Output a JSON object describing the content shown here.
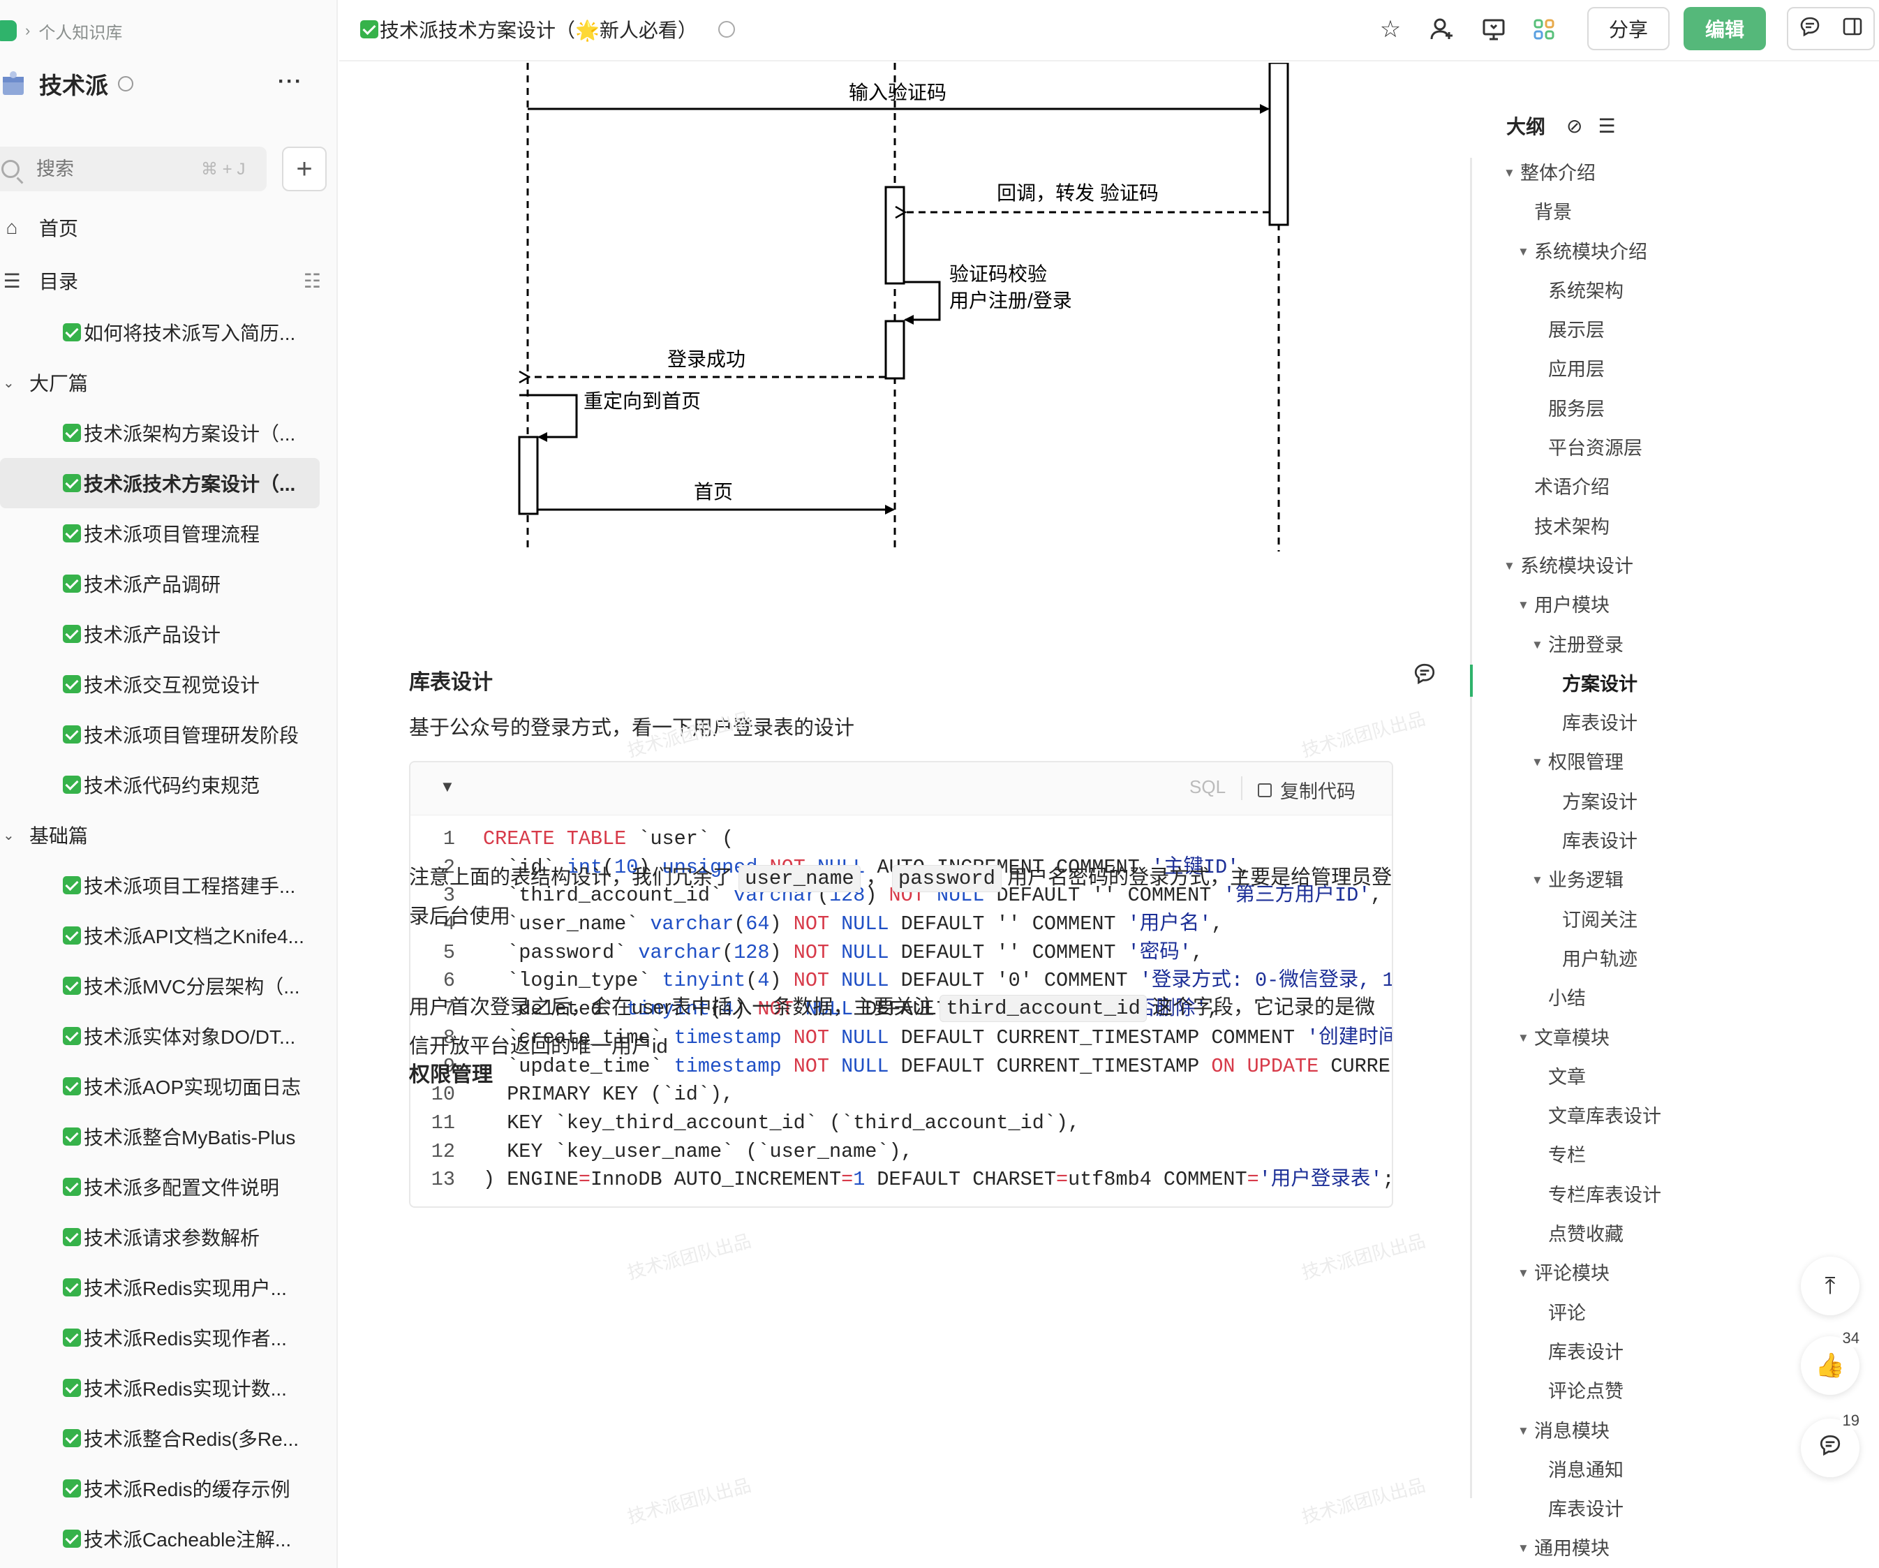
{
  "breadcrumb": {
    "label": "个人知识库"
  },
  "book": {
    "title": "技术派",
    "more": "···"
  },
  "search": {
    "placeholder": "搜索",
    "shortcut": "⌘ + J",
    "add": "+"
  },
  "nav": {
    "home": "首页",
    "toc": "目录"
  },
  "tree": [
    {
      "type": "doc",
      "label": "如何将技术派写入简历..."
    },
    {
      "type": "group",
      "label": "大厂篇"
    },
    {
      "type": "doc",
      "label": "技术派架构方案设计（..."
    },
    {
      "type": "doc",
      "label": "技术派技术方案设计（...",
      "active": true
    },
    {
      "type": "doc",
      "label": "技术派项目管理流程"
    },
    {
      "type": "doc",
      "label": "技术派产品调研"
    },
    {
      "type": "doc",
      "label": "技术派产品设计"
    },
    {
      "type": "doc",
      "label": "技术派交互视觉设计"
    },
    {
      "type": "doc",
      "label": "技术派项目管理研发阶段"
    },
    {
      "type": "doc",
      "label": "技术派代码约束规范"
    },
    {
      "type": "group",
      "label": "基础篇"
    },
    {
      "type": "doc",
      "label": "技术派项目工程搭建手..."
    },
    {
      "type": "doc",
      "label": "技术派API文档之Knife4..."
    },
    {
      "type": "doc",
      "label": "技术派MVC分层架构（..."
    },
    {
      "type": "doc",
      "label": "技术派实体对象DO/DT..."
    },
    {
      "type": "doc",
      "label": "技术派AOP实现切面日志"
    },
    {
      "type": "doc",
      "label": "技术派整合MyBatis-Plus"
    },
    {
      "type": "doc",
      "label": "技术派多配置文件说明"
    },
    {
      "type": "doc",
      "label": "技术派请求参数解析"
    },
    {
      "type": "doc",
      "label": "技术派Redis实现用户..."
    },
    {
      "type": "doc",
      "label": "技术派Redis实现作者..."
    },
    {
      "type": "doc",
      "label": "技术派Redis实现计数..."
    },
    {
      "type": "doc",
      "label": "技术派整合Redis(多Re..."
    },
    {
      "type": "doc",
      "label": "技术派Redis的缓存示例"
    },
    {
      "type": "doc",
      "label": "技术派Cacheable注解..."
    }
  ],
  "topbar": {
    "doc_title": "技术派技术方案设计（🌟新人必看）",
    "share": "分享",
    "edit": "编辑"
  },
  "diagram": {
    "msg1": "输入验证码",
    "msg2": "回调，转发 验证码",
    "self1_line1": "验证码校验",
    "self1_line2": "用户注册/登录",
    "msg3": "登录成功",
    "self2": "重定向到首页",
    "msg4": "首页"
  },
  "section1": {
    "title": "库表设计",
    "intro": "基于公众号的登录方式，看一下用户登录表的设计"
  },
  "code": {
    "lang": "SQL",
    "copy": "复制代码",
    "lines": [
      [
        [
          "kw",
          "CREATE TABLE"
        ],
        [
          "p",
          " `user` ("
        ]
      ],
      [
        [
          "p",
          "  `id` "
        ],
        [
          "ty",
          "int"
        ],
        [
          "p",
          "("
        ],
        [
          "num",
          "10"
        ],
        [
          "p",
          ") "
        ],
        [
          "ty",
          "unsigned"
        ],
        [
          "p",
          " "
        ],
        [
          "kw",
          "NOT"
        ],
        [
          "p",
          " "
        ],
        [
          "ty",
          "NULL"
        ],
        [
          "p",
          " AUTO_INCREMENT COMMENT "
        ],
        [
          "st",
          "'主键ID'"
        ],
        [
          "p",
          ","
        ]
      ],
      [
        [
          "p",
          "  `third_account_id` "
        ],
        [
          "ty",
          "varchar"
        ],
        [
          "p",
          "("
        ],
        [
          "num",
          "128"
        ],
        [
          "p",
          ") "
        ],
        [
          "kw",
          "NOT"
        ],
        [
          "p",
          " "
        ],
        [
          "ty",
          "NULL"
        ],
        [
          "p",
          " DEFAULT '' COMMENT "
        ],
        [
          "st",
          "'第三方用户ID'"
        ],
        [
          "p",
          ","
        ]
      ],
      [
        [
          "p",
          "  `user_name` "
        ],
        [
          "ty",
          "varchar"
        ],
        [
          "p",
          "("
        ],
        [
          "num",
          "64"
        ],
        [
          "p",
          ") "
        ],
        [
          "kw",
          "NOT"
        ],
        [
          "p",
          " "
        ],
        [
          "ty",
          "NULL"
        ],
        [
          "p",
          " DEFAULT '' COMMENT "
        ],
        [
          "st",
          "'用户名'"
        ],
        [
          "p",
          ","
        ]
      ],
      [
        [
          "p",
          "  `password` "
        ],
        [
          "ty",
          "varchar"
        ],
        [
          "p",
          "("
        ],
        [
          "num",
          "128"
        ],
        [
          "p",
          ") "
        ],
        [
          "kw",
          "NOT"
        ],
        [
          "p",
          " "
        ],
        [
          "ty",
          "NULL"
        ],
        [
          "p",
          " DEFAULT '' COMMENT "
        ],
        [
          "st",
          "'密码'"
        ],
        [
          "p",
          ","
        ]
      ],
      [
        [
          "p",
          "  `login_type` "
        ],
        [
          "ty",
          "tinyint"
        ],
        [
          "p",
          "("
        ],
        [
          "num",
          "4"
        ],
        [
          "p",
          ") "
        ],
        [
          "kw",
          "NOT"
        ],
        [
          "p",
          " "
        ],
        [
          "ty",
          "NULL"
        ],
        [
          "p",
          " DEFAULT '0' COMMENT "
        ],
        [
          "st",
          "'登录方式: 0-微信登录, 1-"
        ]
      ],
      [
        [
          "p",
          "  `deleted` "
        ],
        [
          "ty",
          "tinyint"
        ],
        [
          "p",
          "("
        ],
        [
          "num",
          "4"
        ],
        [
          "p",
          ") "
        ],
        [
          "kw",
          "NOT"
        ],
        [
          "p",
          " "
        ],
        [
          "ty",
          "NULL"
        ],
        [
          "p",
          " DEFAULT '0' COMMENT "
        ],
        [
          "st",
          "'是否删除'"
        ],
        [
          "p",
          ","
        ]
      ],
      [
        [
          "p",
          "  `create_time` "
        ],
        [
          "ty",
          "timestamp"
        ],
        [
          "p",
          " "
        ],
        [
          "kw",
          "NOT"
        ],
        [
          "p",
          " "
        ],
        [
          "ty",
          "NULL"
        ],
        [
          "p",
          " DEFAULT CURRENT_TIMESTAMP COMMENT "
        ],
        [
          "st",
          "'创建时间"
        ]
      ],
      [
        [
          "p",
          "  `update_time` "
        ],
        [
          "ty",
          "timestamp"
        ],
        [
          "p",
          " "
        ],
        [
          "kw",
          "NOT"
        ],
        [
          "p",
          " "
        ],
        [
          "ty",
          "NULL"
        ],
        [
          "p",
          " DEFAULT CURRENT_TIMESTAMP "
        ],
        [
          "kw",
          "ON UPDATE"
        ],
        [
          "p",
          " CURREN"
        ]
      ],
      [
        [
          "p",
          "  PRIMARY KEY (`id`),"
        ]
      ],
      [
        [
          "p",
          "  KEY `key_third_account_id` (`third_account_id`),"
        ]
      ],
      [
        [
          "p",
          "  KEY `key_user_name` (`user_name`),"
        ]
      ],
      [
        [
          "p",
          ") ENGINE"
        ],
        [
          "kw",
          "="
        ],
        [
          "p",
          "InnoDB AUTO_INCREMENT"
        ],
        [
          "kw",
          "="
        ],
        [
          "num",
          "1"
        ],
        [
          "p",
          " DEFAULT CHARSET"
        ],
        [
          "kw",
          "="
        ],
        [
          "p",
          "utf8mb4 COMMENT"
        ],
        [
          "kw",
          "="
        ],
        [
          "st",
          "'用户登录表'"
        ],
        [
          "p",
          ";"
        ]
      ]
    ]
  },
  "para1": {
    "a": "注意上面的表结构设计，我们冗余了 ",
    "c1": "user_name",
    "b": " ， ",
    "c2": "password",
    "c": " 用户名密码的登录方式，主要是给管理员登录后台使用"
  },
  "para2": {
    "a": "用户首次登录之后，会在user表中插入一条数据，主要关注 ",
    "c1": "third_account_id",
    "b": " 这个字段，它记录的是微信开放平台返回的唯一用户id"
  },
  "section2": {
    "title": "权限管理"
  },
  "watermark": "技术派团队出品",
  "outline": {
    "title": "大纲",
    "items": [
      {
        "label": "整体介绍",
        "level": 0,
        "caret": true
      },
      {
        "label": "背景",
        "level": 1
      },
      {
        "label": "系统模块介绍",
        "level": 1,
        "caret": true
      },
      {
        "label": "系统架构",
        "level": 2
      },
      {
        "label": "展示层",
        "level": 2
      },
      {
        "label": "应用层",
        "level": 2
      },
      {
        "label": "服务层",
        "level": 2
      },
      {
        "label": "平台资源层",
        "level": 2
      },
      {
        "label": "术语介绍",
        "level": 1
      },
      {
        "label": "技术架构",
        "level": 1
      },
      {
        "label": "系统模块设计",
        "level": 0,
        "caret": true
      },
      {
        "label": "用户模块",
        "level": 1,
        "caret": true
      },
      {
        "label": "注册登录",
        "level": 2,
        "caret": true
      },
      {
        "label": "方案设计",
        "level": 3,
        "current": true
      },
      {
        "label": "库表设计",
        "level": 3
      },
      {
        "label": "权限管理",
        "level": 2,
        "caret": true
      },
      {
        "label": "方案设计",
        "level": 3
      },
      {
        "label": "库表设计",
        "level": 3
      },
      {
        "label": "业务逻辑",
        "level": 2,
        "caret": true
      },
      {
        "label": "订阅关注",
        "level": 3
      },
      {
        "label": "用户轨迹",
        "level": 3
      },
      {
        "label": "小结",
        "level": 2
      },
      {
        "label": "文章模块",
        "level": 1,
        "caret": true
      },
      {
        "label": "文章",
        "level": 2
      },
      {
        "label": "文章库表设计",
        "level": 2
      },
      {
        "label": "专栏",
        "level": 2
      },
      {
        "label": "专栏库表设计",
        "level": 2
      },
      {
        "label": "点赞收藏",
        "level": 2
      },
      {
        "label": "评论模块",
        "level": 1,
        "caret": true
      },
      {
        "label": "评论",
        "level": 2
      },
      {
        "label": "库表设计",
        "level": 2
      },
      {
        "label": "评论点赞",
        "level": 2
      },
      {
        "label": "消息模块",
        "level": 1,
        "caret": true
      },
      {
        "label": "消息通知",
        "level": 2
      },
      {
        "label": "库表设计",
        "level": 2
      },
      {
        "label": "通用模块",
        "level": 1,
        "caret": true
      }
    ]
  },
  "fabs": {
    "like_count": "34",
    "comment_count": "19"
  },
  "colors": {
    "accent": "#55b87a",
    "check": "#36b24a",
    "keyword": "#d73a49",
    "type": "#1f4fc5",
    "string": "#1c2f97"
  }
}
